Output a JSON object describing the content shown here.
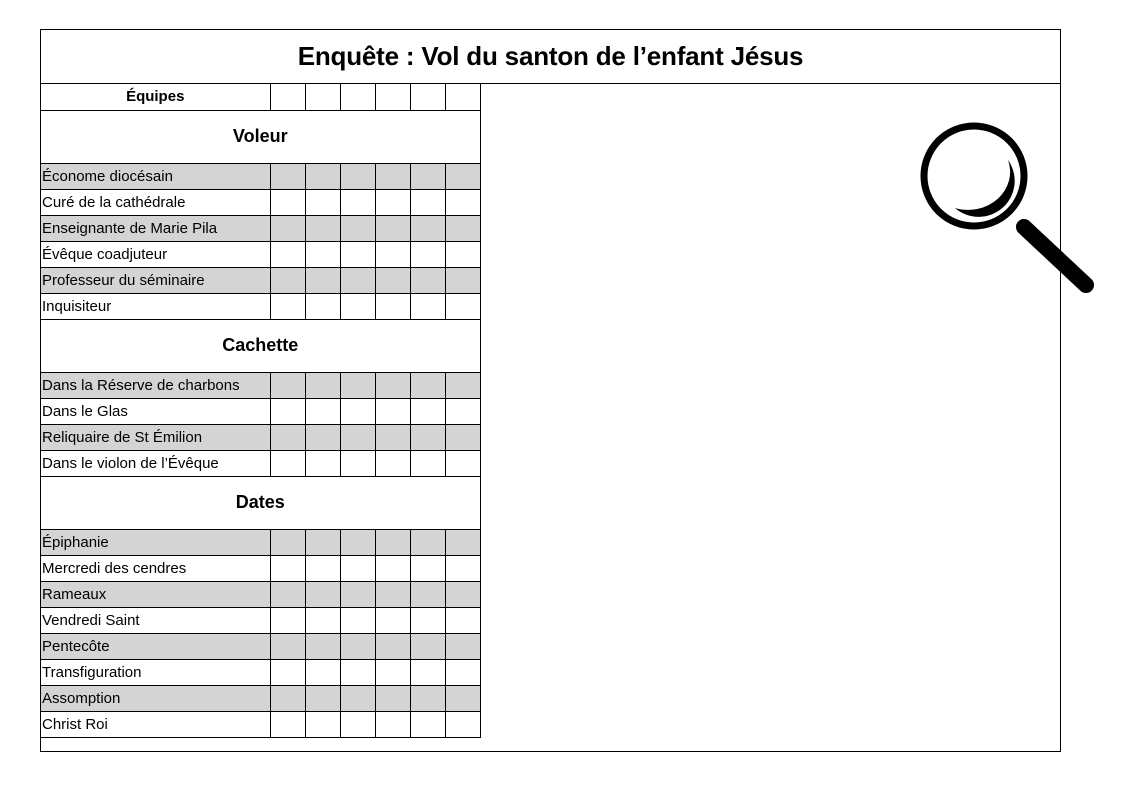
{
  "title": "Enquête : Vol du santon de l’enfant Jésus",
  "header": {
    "label": "Équipes"
  },
  "sections": [
    {
      "title": "Voleur",
      "items": [
        "Économe diocésain",
        "Curé de la cathédrale",
        "Enseignante de Marie Pila",
        "Évêque coadjuteur",
        "Professeur du séminaire",
        "Inquisiteur"
      ]
    },
    {
      "title": "Cachette",
      "items": [
        "Dans la Réserve de charbons",
        "Dans le Glas",
        "Reliquaire de St Émilion",
        "Dans le violon de l’Évêque"
      ]
    },
    {
      "title": "Dates",
      "items": [
        "Épiphanie",
        "Mercredi des cendres",
        "Rameaux",
        "Vendredi Saint",
        "Pentecôte",
        "Transfiguration",
        "Assomption",
        "Christ Roi"
      ]
    }
  ],
  "team_columns": 6,
  "colors": {
    "shade": "#d4d4d4",
    "border": "#000000"
  },
  "icons": {
    "illustration": "magnifying-glass-icon"
  }
}
